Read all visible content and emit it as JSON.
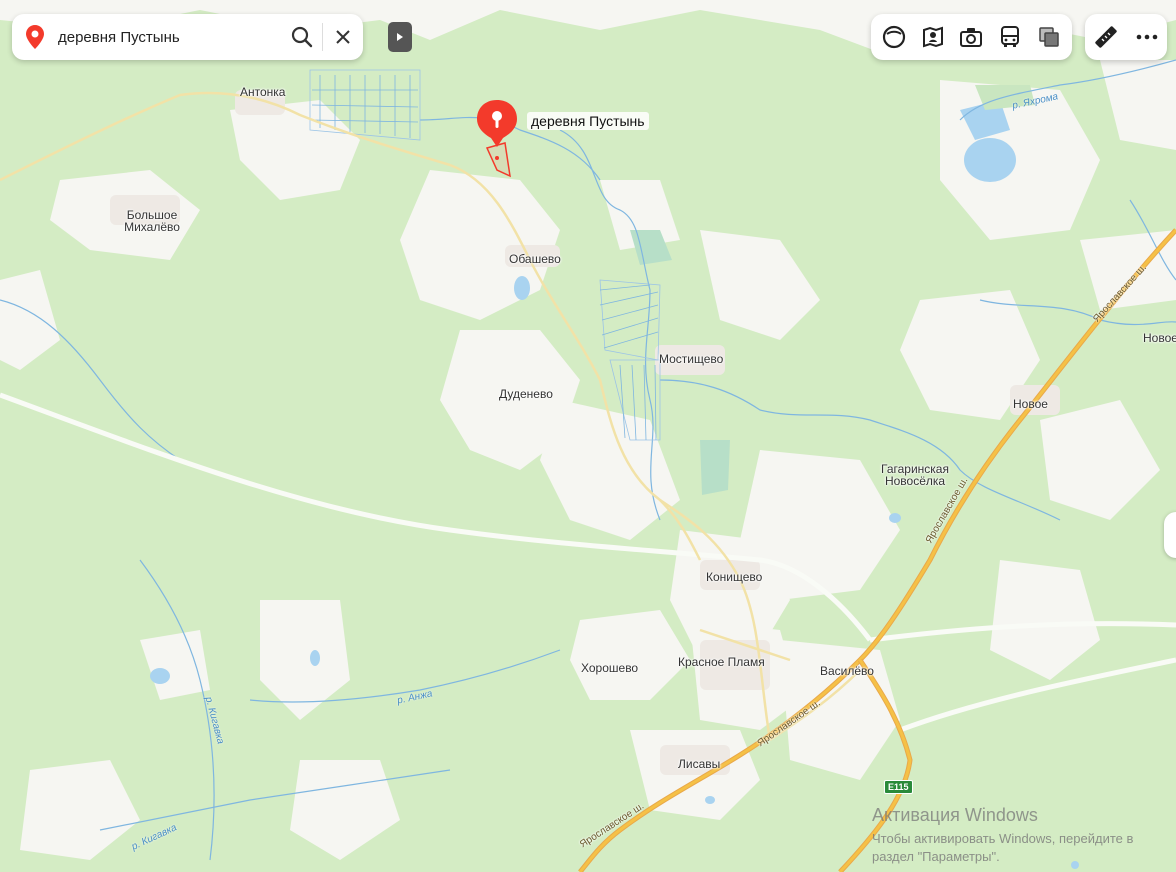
{
  "search": {
    "query": "деревня Пустынь"
  },
  "marker": {
    "label": "деревня Пустынь"
  },
  "places": {
    "antonka": "Антонка",
    "bolshoe": "Большое",
    "mikhalevo": "Михалёво",
    "obashevo": "Обашево",
    "mostishchevo": "Мостищево",
    "dudenevo": "Дуденево",
    "novoe": "Новое",
    "novoe_edge": "Новое",
    "gagarinskaya": "Гагаринская",
    "novoselka": "Новосёлка",
    "konishchevo": "Конищево",
    "khoroshevo": "Хорошево",
    "krasnoe_plamya": "Красное Пламя",
    "vasilevo": "Василёво",
    "lisavy": "Лисавы"
  },
  "rivers": {
    "yakhroma": "р. Яхрома",
    "anzha": "р. Анжа",
    "kigovka1": "р. Кигавка",
    "kigovka2": "р. Кигавка"
  },
  "roads": {
    "yar1": "Ярославское ш.",
    "yar2": "Ярославское ш.",
    "yar3": "Ярославское ш.",
    "yar4": "Ярославское ш.",
    "e115": "E115"
  },
  "watermark": {
    "title": "Активация Windows",
    "line1": "Чтобы активировать Windows, перейдите в",
    "line2": "раздел \"Параметры\"."
  },
  "colors": {
    "forest": "#d4ecc4",
    "field": "#f6f6f2",
    "water": "#a9d3f0",
    "highway": "#f5c146",
    "marker": "#f33a2b"
  },
  "icons": {
    "toolbar": [
      "layers-circle-icon",
      "panorama-map-icon",
      "camera-icon",
      "bus-icon",
      "layers-stack-icon"
    ],
    "toolbar2": [
      "ruler-icon",
      "more-icon"
    ]
  }
}
